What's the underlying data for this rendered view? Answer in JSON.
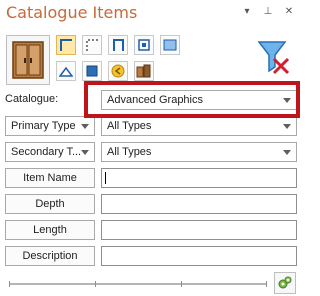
{
  "window": {
    "title": "Catalogue Items",
    "controls": [
      "dropdown-arrow-icon",
      "pin-icon",
      "close-icon"
    ]
  },
  "toolbar": {
    "main_icon": "cabinet-icon",
    "view_buttons": [
      {
        "name": "corner-l-icon",
        "selected": true
      },
      {
        "name": "dotted-corner-icon",
        "selected": false
      },
      {
        "name": "frame-icon",
        "selected": false
      },
      {
        "name": "grid-icon",
        "selected": false
      },
      {
        "name": "window-icon",
        "selected": false
      },
      {
        "name": "arrow-up-icon",
        "selected": false
      },
      {
        "name": "box-icon",
        "selected": false
      },
      {
        "name": "arrow-left-circle-icon",
        "selected": false
      },
      {
        "name": "objects-icon",
        "selected": false
      }
    ],
    "filter_icon": "filter-clear-icon"
  },
  "catalogue": {
    "label": "Catalogue:",
    "value": "Advanced Graphics"
  },
  "filters": [
    {
      "label": "Primary Type",
      "value": "All Types"
    },
    {
      "label": "Secondary T...",
      "value": "All Types"
    }
  ],
  "fields": [
    {
      "label": "Item Name",
      "value": ""
    },
    {
      "label": "Depth",
      "value": ""
    },
    {
      "label": "Length",
      "value": ""
    },
    {
      "label": "Description",
      "value": ""
    }
  ],
  "footer": {
    "settings_icon": "settings-icon"
  },
  "colors": {
    "title": "#c7693a",
    "highlight": "#c0141b",
    "selected_button": "#ffe8a8"
  }
}
